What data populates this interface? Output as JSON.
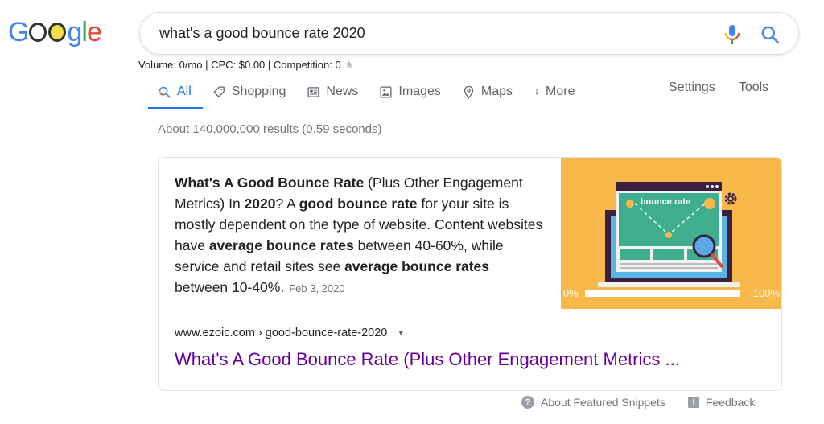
{
  "logo": {
    "alt": "Google"
  },
  "search": {
    "query": "what's a good bounce rate 2020",
    "mic_icon": "microphone-icon",
    "search_icon": "search-icon"
  },
  "keyword_stats": {
    "text": "Volume: 0/mo | CPC: $0.00 | Competition: 0",
    "icon": "star-icon"
  },
  "tabs": [
    {
      "label": "All",
      "icon": "search-icon",
      "active": true
    },
    {
      "label": "Shopping",
      "icon": "tag-icon"
    },
    {
      "label": "News",
      "icon": "newspaper-icon"
    },
    {
      "label": "Images",
      "icon": "image-icon"
    },
    {
      "label": "Maps",
      "icon": "map-pin-icon"
    },
    {
      "label": "More",
      "icon": "more-vert-icon"
    }
  ],
  "tools": {
    "settings": "Settings",
    "tools": "Tools"
  },
  "result_stats": "About 140,000,000 results (0.59 seconds)",
  "featured_snippet": {
    "segments": [
      {
        "text": "What's A Good Bounce Rate",
        "bold": true
      },
      {
        "text": " (Plus Other Engagement Metrics) In ",
        "bold": false
      },
      {
        "text": "2020",
        "bold": true
      },
      {
        "text": "? A ",
        "bold": false
      },
      {
        "text": "good bounce rate",
        "bold": true
      },
      {
        "text": " for your site is mostly dependent on the type of website. Content websites have ",
        "bold": false
      },
      {
        "text": "average bounce rates",
        "bold": true
      },
      {
        "text": " between 40-60%, while service and retail sites see ",
        "bold": false
      },
      {
        "text": "average bounce rates",
        "bold": true
      },
      {
        "text": " between 10-40%.",
        "bold": false
      }
    ],
    "date": "Feb 3, 2020",
    "image": {
      "label": "bounce rate",
      "scale_min": "0%",
      "scale_max": "100%",
      "bg_color": "#f9b94a"
    },
    "cite": "www.ezoic.com › good-bounce-rate-2020",
    "title": "What's A Good Bounce Rate (Plus Other Engagement Metrics ..."
  },
  "footer": {
    "about": "About Featured Snippets",
    "feedback": "Feedback"
  },
  "colors": {
    "accent": "#1a73e8",
    "visited_link": "#660099",
    "muted": "#70757a"
  }
}
